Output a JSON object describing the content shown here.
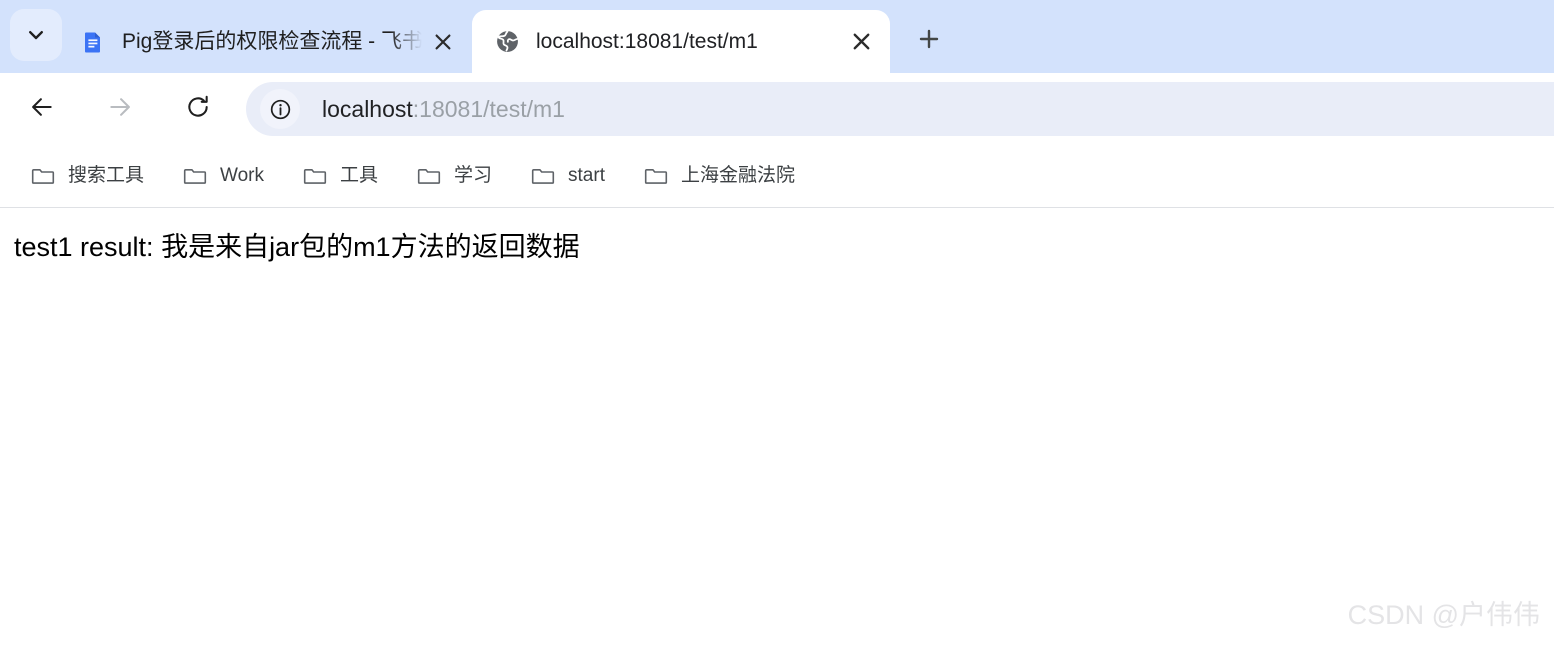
{
  "browser": {
    "tab_strip": {
      "tab_list_button": {
        "icon": "chevron-down-icon",
        "tooltip": "Search tabs"
      },
      "new_tab_button": {
        "icon": "plus-icon",
        "tooltip": "New tab"
      },
      "tabs": [
        {
          "title": "Pig登录后的权限检查流程 - 飞书",
          "favicon": "document-icon",
          "active": false,
          "close_icon": "close-icon"
        },
        {
          "title": "localhost:18081/test/m1",
          "favicon": "globe-icon",
          "active": true,
          "close_icon": "close-icon"
        }
      ]
    },
    "toolbar": {
      "back_button": {
        "icon": "arrow-left-icon",
        "enabled": true
      },
      "forward_button": {
        "icon": "arrow-right-icon",
        "enabled": false
      },
      "reload_button": {
        "icon": "reload-icon",
        "enabled": true
      },
      "omnibox": {
        "site_info_icon": "info-circle-icon",
        "url_host": "localhost",
        "url_path": ":18081/test/m1",
        "full_url": "localhost:18081/test/m1"
      }
    },
    "bookmarks_bar": {
      "items": [
        {
          "label": "搜索工具",
          "icon": "folder-icon"
        },
        {
          "label": "Work",
          "icon": "folder-icon"
        },
        {
          "label": "工具",
          "icon": "folder-icon"
        },
        {
          "label": "学习",
          "icon": "folder-icon"
        },
        {
          "label": "start",
          "icon": "folder-icon"
        },
        {
          "label": "上海金融法院",
          "icon": "folder-icon"
        }
      ]
    }
  },
  "page": {
    "body_text": "test1 result: 我是来自jar包的m1方法的返回数据",
    "watermark": "CSDN @户伟伟"
  },
  "colors": {
    "tabstrip_bg": "#d3e2fc",
    "active_tab_bg": "#ffffff",
    "omnibox_bg": "#e9edf8",
    "url_host_text": "#202124",
    "url_path_text": "#9aa0a6",
    "bookmark_text": "#3c4043",
    "page_text": "#000000",
    "watermark_text": "#e4e4e6",
    "docs_favicon": "#3b73f5"
  }
}
